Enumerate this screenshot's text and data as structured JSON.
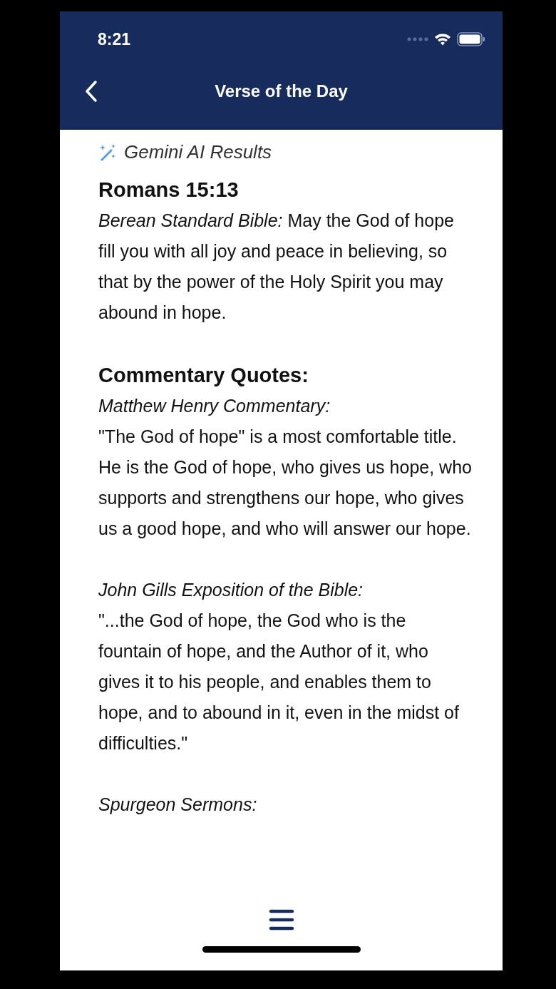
{
  "status_bar": {
    "time": "8:21"
  },
  "header": {
    "title": "Verse of the Day"
  },
  "ai_label": "Gemini AI Results",
  "verse": {
    "reference": "Romans 15:13",
    "translation": "Berean Standard Bible:",
    "text": "May the God of hope fill you with all joy and peace in believing, so that by the power of the Holy Spirit you may abound in hope."
  },
  "commentary": {
    "heading": "Commentary Quotes:",
    "quotes": [
      {
        "source": "Matthew Henry Commentary:",
        "text": "\"The God of hope\" is a most comfortable title. He is the God of hope, who gives us hope, who supports and strengthens our hope, who gives us a good hope, and who will answer our hope."
      },
      {
        "source": "John Gills Exposition of the Bible:",
        "text": "\"...the God of hope, the God who is the fountain of hope, and the Author of it, who gives it to his people, and enables them to hope, and to abound in it, even in the midst of difficulties.\""
      },
      {
        "source": "Spurgeon Sermons:"
      }
    ]
  }
}
